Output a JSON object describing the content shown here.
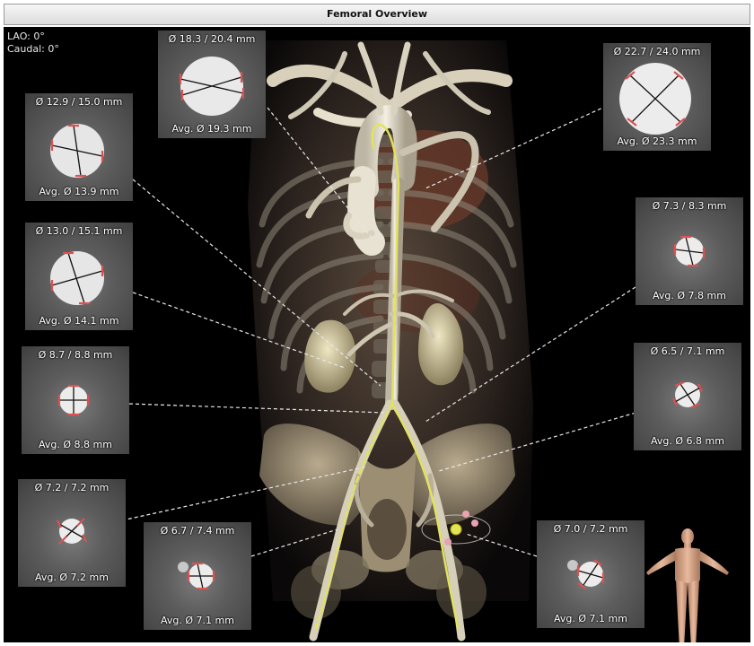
{
  "window": {
    "title": "Femoral Overview"
  },
  "orientation": {
    "lao": "LAO: 0°",
    "caudal": "Caudal: 0°"
  },
  "colors": {
    "vessel_path": "#e3e35a",
    "marker": "#e05050",
    "handle": "#e9a3b0",
    "panel_bg": "#5a5a5a"
  },
  "cross_sections": [
    {
      "id": "aortic-arch",
      "measure": "Ø 18.3 / 20.4 mm",
      "average": "Avg. Ø 19.3 mm"
    },
    {
      "id": "ascending-aorta",
      "measure": "Ø 22.7 / 24.0 mm",
      "average": "Avg. Ø 23.3 mm"
    },
    {
      "id": "descending-aorta",
      "measure": "Ø 12.9 / 15.0 mm",
      "average": "Avg. Ø 13.9 mm"
    },
    {
      "id": "abdominal-aorta",
      "measure": "Ø 13.0 / 15.1 mm",
      "average": "Avg. Ø 14.1 mm"
    },
    {
      "id": "right-common-iliac",
      "measure": "Ø 8.7 / 8.8 mm",
      "average": "Avg. Ø 8.8 mm"
    },
    {
      "id": "right-external-iliac",
      "measure": "Ø 7.2 / 7.2 mm",
      "average": "Avg. Ø 7.2 mm"
    },
    {
      "id": "right-femoral",
      "measure": "Ø 6.7 / 7.4 mm",
      "average": "Avg. Ø 7.1 mm"
    },
    {
      "id": "left-common-iliac",
      "measure": "Ø 7.3 / 8.3 mm",
      "average": "Avg. Ø 7.8 mm"
    },
    {
      "id": "left-external-iliac",
      "measure": "Ø 6.5 / 7.1 mm",
      "average": "Avg. Ø 6.8 mm"
    },
    {
      "id": "left-femoral",
      "measure": "Ø 7.0 / 7.2 mm",
      "average": "Avg. Ø 7.1 mm"
    }
  ]
}
